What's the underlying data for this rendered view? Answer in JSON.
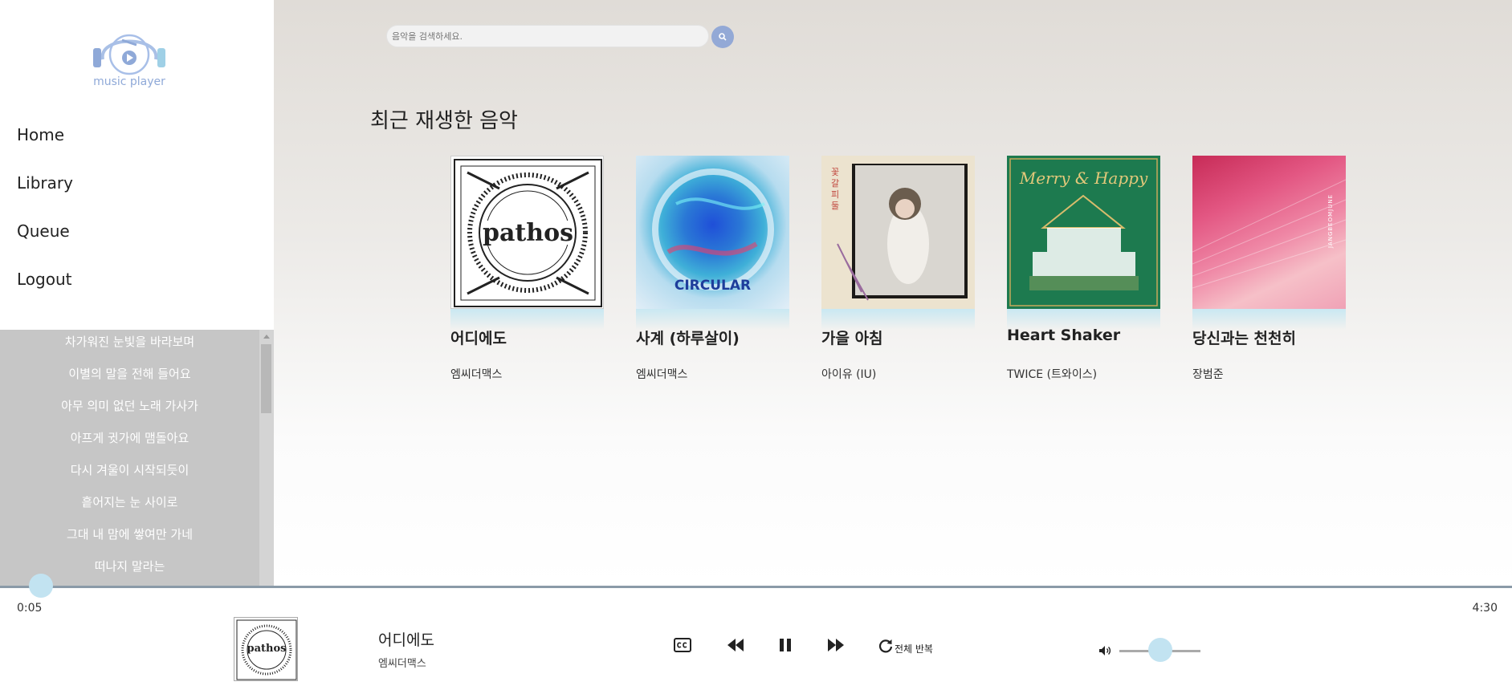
{
  "app": {
    "logo_text": "music player"
  },
  "nav": [
    {
      "label": "Home"
    },
    {
      "label": "Library"
    },
    {
      "label": "Queue"
    },
    {
      "label": "Logout"
    }
  ],
  "lyrics": [
    "차가워진 눈빛을 바라보며",
    "이별의 말을 전해 들어요",
    "아무 의미 없던 노래 가사가",
    "아프게 귓가에 맴돌아요",
    "다시 겨울이 시작되듯이",
    "흩어지는 눈 사이로",
    "그대 내 맘에 쌓여만 가네",
    "떠나지 말라는"
  ],
  "search": {
    "placeholder": "음악을 검색하세요."
  },
  "section_title": "최근 재생한 음악",
  "albums": [
    {
      "title": "어디에도",
      "artist": "엠씨더맥스",
      "cover_text": "pathos"
    },
    {
      "title": "사계 (하루살이)",
      "artist": "엠씨더맥스",
      "cover_text": "CIRCULAR"
    },
    {
      "title": "가을 아침",
      "artist": "아이유 (IU)",
      "cover_text": "꽃갈피 둘"
    },
    {
      "title": "Heart Shaker",
      "artist": "TWICE (트와이스)",
      "cover_text": "Merry & Happy"
    },
    {
      "title": "당신과는 천천히",
      "artist": "장범준",
      "cover_text": "JANGBEOMJUNE"
    }
  ],
  "player": {
    "current_time": "0:05",
    "total_time": "4:30",
    "title": "어디에도",
    "artist": "엠씨더맥스",
    "repeat_label": "전체 반복",
    "progress": 0.019,
    "volume": 0.5
  },
  "colors": {
    "accent": "#93a9d6",
    "knob": "#c2e3f1",
    "lyrics_bg": "#c6c6c6"
  }
}
